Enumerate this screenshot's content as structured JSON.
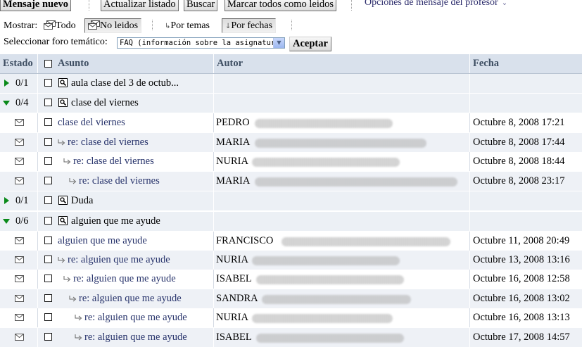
{
  "toolbar": {
    "new_message": "Mensaje nuevo",
    "refresh": "Actualizar listado",
    "search": "Buscar",
    "mark_all_read": "Marcar todos como leidos",
    "teacher_options": "Opciones de mensaje del profesor"
  },
  "filters": {
    "show_label": "Mostrar:",
    "all": "Todo",
    "unread": "No leidos",
    "by_topic": "Por temas",
    "by_date": "Por fechas",
    "forum_label": "Seleccionar foro temático:",
    "forum_value": "FAQ (información sobre la asignatura)",
    "accept": "Aceptar"
  },
  "table": {
    "columns": {
      "estado": "Estado",
      "asunto": "Asunto",
      "autor": "Autor",
      "fecha": "Fecha"
    },
    "topics": [
      {
        "count": "0/1",
        "subject": "aula clase del 3 de octub...",
        "expanded": false
      },
      {
        "count": "0/4",
        "subject": "clase del viernes",
        "expanded": true
      },
      {
        "count": "0/1",
        "subject": "Duda",
        "expanded": false
      },
      {
        "count": "0/6",
        "subject": "alguien que me ayude",
        "expanded": true
      }
    ],
    "messages": [
      {
        "subject": "clase del viernes",
        "author": "PEDRO",
        "date": "Octubre 8, 2008 17:21"
      },
      {
        "subject": "re: clase del viernes",
        "author": "MARIA",
        "date": "Octubre 8, 2008 17:44"
      },
      {
        "subject": "re: clase del viernes",
        "author": "NURIA",
        "date": "Octubre 8, 2008 18:44"
      },
      {
        "subject": "re: clase del viernes",
        "author": "MARIA",
        "date": "Octubre 8, 2008 23:17"
      },
      {
        "subject": "alguien que me ayude",
        "author": "FRANCISCO",
        "date": "Octubre 11, 2008 20:49"
      },
      {
        "subject": "re: alguien que me ayude",
        "author": "NURIA",
        "date": "Octubre 13, 2008 13:16"
      },
      {
        "subject": "re: alguien que me ayude",
        "author": "ISABEL",
        "date": "Octubre 16, 2008 12:58"
      },
      {
        "subject": "re: alguien que me ayude",
        "author": "SANDRA",
        "date": "Octubre 16, 2008 13:02"
      },
      {
        "subject": "re: alguien que me ayude",
        "author": "NURIA",
        "date": "Octubre 16, 2008 13:13"
      },
      {
        "subject": "re: alguien que me ayude",
        "author": "ISABEL",
        "date": "Octubre 17, 2008 14:57"
      }
    ]
  },
  "colors": {
    "header_bg": "#d9e1ec",
    "row_alt": "#eef1f6",
    "link": "#27336b",
    "expand_arrow": "#0a8a1a"
  },
  "icons": [
    "envelope-icon",
    "magnifier-icon",
    "reply-arrow-icon",
    "expand-arrow-icon",
    "collapse-arrow-icon",
    "chevron-down-icon"
  ]
}
